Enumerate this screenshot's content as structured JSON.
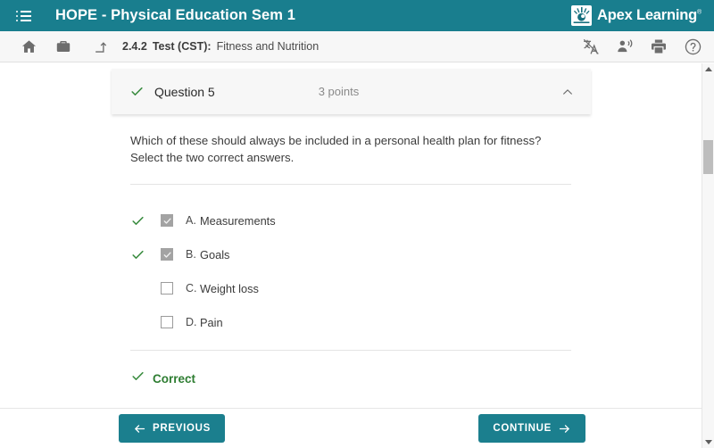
{
  "topbar": {
    "menu_icon": "list-menu-icon",
    "course_title": "HOPE - Physical Education Sem 1",
    "brand_name": "Apex Learning",
    "brand_tm": "®",
    "brand_icon": "apex-sunburst-logo-icon",
    "accent_color": "#197e8e"
  },
  "toolbar": {
    "home_icon": "home-icon",
    "briefcase_icon": "briefcase-icon",
    "level_up_icon": "level-up-arrow-icon",
    "breadcrumb": {
      "number": "2.4.2",
      "type": "Test (CST):",
      "title": "Fitness and Nutrition"
    },
    "translate_icon": "translate-icon",
    "read_aloud_icon": "read-aloud-icon",
    "print_icon": "print-icon",
    "help_icon": "help-circle-icon"
  },
  "question": {
    "status_icon": "green-check-icon",
    "label": "Question 5",
    "points": "3 points",
    "collapse_icon": "chevron-up-icon",
    "prompt": "Which of these should always be included in a personal health plan for fitness? Select the two correct answers.",
    "choices": [
      {
        "letter": "A.",
        "text": "Measurements",
        "checked": true,
        "correct": true
      },
      {
        "letter": "B.",
        "text": "Goals",
        "checked": true,
        "correct": true
      },
      {
        "letter": "C.",
        "text": "Weight loss",
        "checked": false,
        "correct": false
      },
      {
        "letter": "D.",
        "text": "Pain",
        "checked": false,
        "correct": false
      }
    ],
    "result": {
      "icon": "green-check-icon",
      "label": "Correct",
      "color": "#2e7d32"
    }
  },
  "scrollbar": {
    "up_icon": "scroll-up-arrow-icon",
    "down_icon": "scroll-down-arrow-icon",
    "thumb": "scroll-thumb"
  },
  "footer": {
    "previous_label": "PREVIOUS",
    "previous_icon": "arrow-left-icon",
    "continue_label": "CONTINUE",
    "continue_icon": "arrow-right-icon",
    "button_color": "#1b7f8e"
  }
}
